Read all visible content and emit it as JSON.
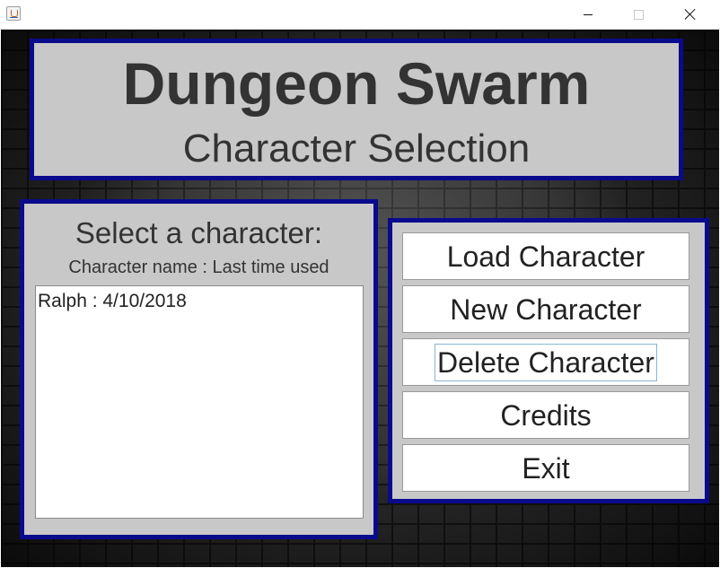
{
  "window": {
    "app_icon": "java-cup-icon",
    "controls": [
      "minimize-icon",
      "maximize-icon",
      "close-icon"
    ]
  },
  "header": {
    "title": "Dungeon Swarm",
    "subtitle": "Character Selection"
  },
  "selection": {
    "heading": "Select a character:",
    "column_header": "Character name : Last time used",
    "characters": [
      "Ralph : 4/10/2018"
    ]
  },
  "buttons": {
    "load": "Load Character",
    "new": "New Character",
    "delete": "Delete Character",
    "credits": "Credits",
    "exit": "Exit",
    "focused": "delete"
  },
  "colors": {
    "panel_background": "#c8c8c8",
    "panel_border": "#0a0a8c",
    "text": "#333333",
    "background": "#2a2a2a"
  }
}
